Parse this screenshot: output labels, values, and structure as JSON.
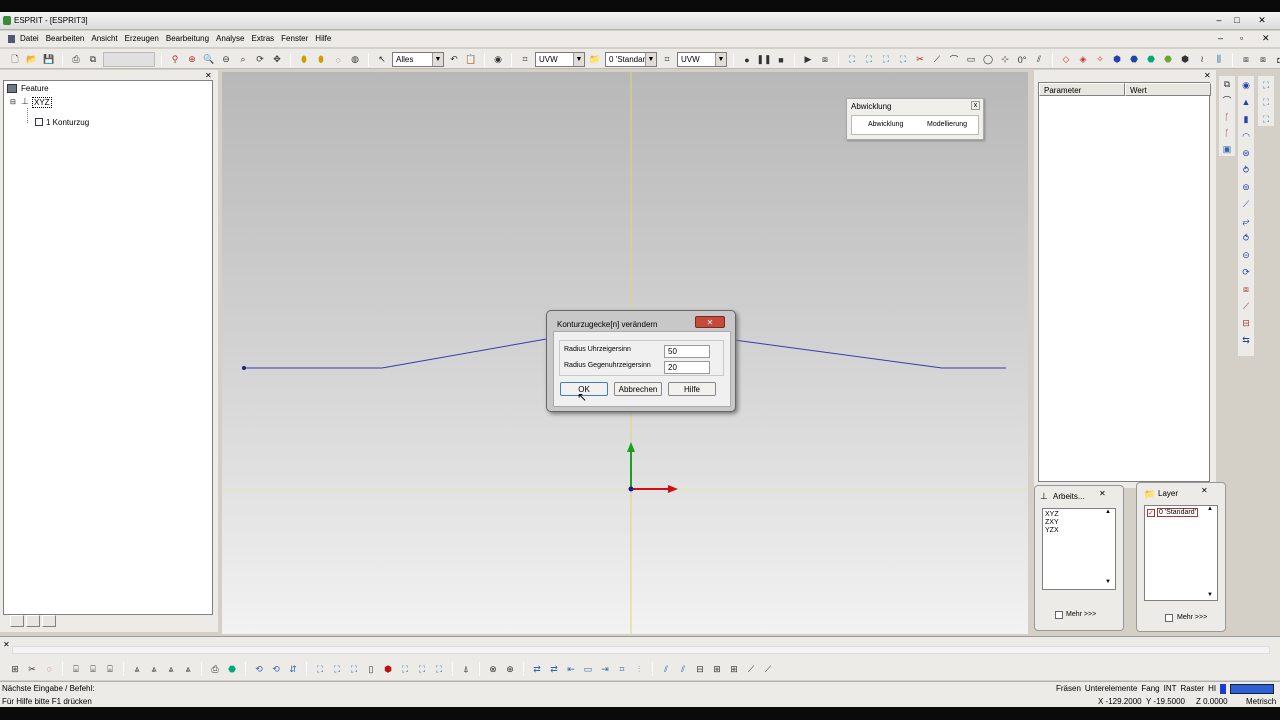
{
  "window": {
    "title": "ESPRIT - [ESPRIT3]"
  },
  "menubar": [
    "Datei",
    "Bearbeiten",
    "Ansicht",
    "Erzeugen",
    "Bearbeitung",
    "Analyse",
    "Extras",
    "Fenster",
    "Hilfe"
  ],
  "toolbar": {
    "select_combo": "Alles",
    "plane_combo_1": "UVW",
    "layer_combo": "0 'Standard'",
    "plane_combo_2": "UVW"
  },
  "feature_tree": {
    "root": "Feature",
    "plane": "XYZ",
    "item": "1 Konturzug"
  },
  "abwicklung": {
    "title": "Abwicklung",
    "button_1": "Abwicklung",
    "button_2": "Modellierung"
  },
  "dialog": {
    "title": "Konturzugecke[n] verändern",
    "label_1": "Radius Uhrzeigersinn",
    "value_1": "50",
    "label_2": "Radius Gegenuhrzeigersinn",
    "value_2": "20",
    "ok": "OK",
    "cancel": "Abbrechen",
    "help": "Hilfe"
  },
  "properties": {
    "col_param": "Parameter",
    "col_value": "Wert"
  },
  "arbeits": {
    "title": "Arbeits...",
    "items": [
      "XYZ",
      "ZXY",
      "YZX"
    ],
    "more": "Mehr >>>"
  },
  "layer": {
    "title": "Layer",
    "item": "0 'Standard'",
    "more": "Mehr >>>"
  },
  "status": {
    "prompt": "Nächste Eingabe / Befehl:",
    "hint": "Für Hilfe bitte F1 drücken",
    "modes": [
      "Fräsen",
      "Unterelemente",
      "Fang",
      "INT",
      "Raster",
      "HI"
    ],
    "coord_x": "X -129.2000",
    "coord_y": "Y -19.5000",
    "coord_z": "Z 0.0000",
    "units": "Metrisch"
  },
  "colors": {
    "viewport_top": "#b9b9b9",
    "viewport_bottom": "#f0f0f0",
    "axis_y": "#1aa01a",
    "axis_x": "#d01010",
    "contour": "#3a3aa8"
  }
}
